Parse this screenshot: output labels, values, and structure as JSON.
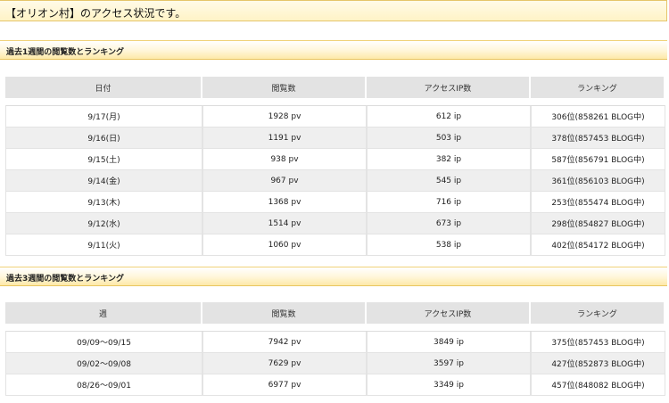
{
  "page_title": "【オリオン村】のアクセス状況です。",
  "weekly": {
    "header": "過去1週間の閲覧数とランキング",
    "columns": [
      "日付",
      "閲覧数",
      "アクセスIP数",
      "ランキング"
    ],
    "rows": [
      [
        "9/17(月)",
        "1928 pv",
        "612 ip",
        "306位(858261 BLOG中)"
      ],
      [
        "9/16(日)",
        "1191 pv",
        "503 ip",
        "378位(857453 BLOG中)"
      ],
      [
        "9/15(土)",
        "938 pv",
        "382 ip",
        "587位(856791 BLOG中)"
      ],
      [
        "9/14(金)",
        "967 pv",
        "545 ip",
        "361位(856103 BLOG中)"
      ],
      [
        "9/13(木)",
        "1368 pv",
        "716 ip",
        "253位(855474 BLOG中)"
      ],
      [
        "9/12(水)",
        "1514 pv",
        "673 ip",
        "298位(854827 BLOG中)"
      ],
      [
        "9/11(火)",
        "1060 pv",
        "538 ip",
        "402位(854172 BLOG中)"
      ]
    ]
  },
  "threeweek": {
    "header": "過去3週間の閲覧数とランキング",
    "columns": [
      "週",
      "閲覧数",
      "アクセスIP数",
      "ランキング"
    ],
    "rows": [
      [
        "09/09～09/15",
        "7942 pv",
        "3849 ip",
        "375位(857453 BLOG中)"
      ],
      [
        "09/02～09/08",
        "7629 pv",
        "3597 ip",
        "427位(852873 BLOG中)"
      ],
      [
        "08/26～09/01",
        "6977 pv",
        "3349 ip",
        "457位(848082 BLOG中)"
      ]
    ]
  }
}
